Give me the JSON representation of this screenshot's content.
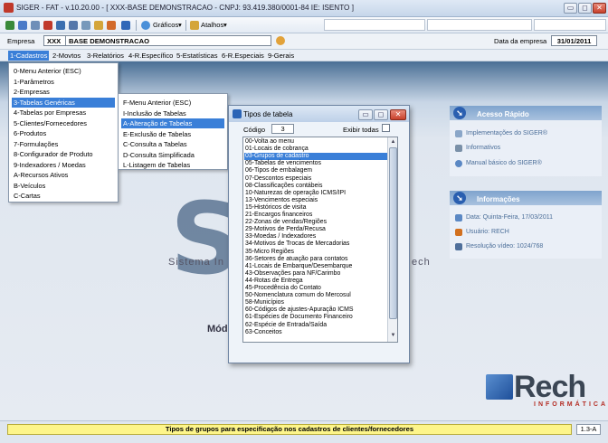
{
  "window": {
    "title": "SIGER - FAT - v.10.20.00 - [ XXX-BASE DEMONSTRACAO - CNPJ: 93.419.380/0001-84 IE: ISENTO ]",
    "minimize": "▭",
    "maximize": "◻",
    "close": "✕"
  },
  "toolbar": {
    "graficos": "Gráficos",
    "atalhos": "Atalhos"
  },
  "empresa": {
    "label": "Empresa",
    "code": "XXX",
    "name": "BASE DEMONSTRACAO",
    "date_label": "Data da empresa",
    "date": "31/01/2011"
  },
  "menu": [
    "1-Cadastros",
    "2-Movtos",
    "3-Relatórios",
    "4-R.Específico",
    "5-Estatísticas",
    "6-R.Especiais",
    "9-Gerais"
  ],
  "cadastros_menu": [
    "0-Menu Anterior (ESC)",
    "1-Parâmetros",
    "2-Empresas",
    "3-Tabelas Genéricas",
    "4-Tabelas por Empresas",
    "5-Clientes/Fornecedores",
    "6-Produtos",
    "7-Formulações",
    "8-Configurador de Produto",
    "9-Indexadores / Moedas",
    "A-Recursos Ativos",
    "B-Veículos",
    "C-Cartas"
  ],
  "tabelas_menu": [
    "F-Menu Anterior (ESC)",
    "I-Inclusão de Tabelas",
    "A-Alteração de Tabelas",
    "E-Exclusão de Tabelas",
    "C-Consulta a Tabelas",
    "D-Consulta Simplificada",
    "L-Listagem de Tabelas"
  ],
  "dialog": {
    "title": "Tipos de tabela",
    "code_label": "Código",
    "code_value": "3",
    "exibir_label": "Exibir todas",
    "items": [
      "00-Volta ao menu",
      "01-Locais de cobrança",
      "03-Grupos de cadastro",
      "05-Tabelas de vencimentos",
      "06-Tipos de embalagem",
      "07-Descontos especiais",
      "08-Classificações contábeis",
      "10-Naturezas de operação ICMS/IPI",
      "13-Vencimentos especiais",
      "15-Históricos de visita",
      "21-Encargos financeiros",
      "22-Zonas de vendas/Regiões",
      "29-Motivos de Perda/Recusa",
      "33-Moedas / Indexadores",
      "34-Motivos de Trocas de Mercadorias",
      "35-Micro Regiões",
      "36-Setores de atuação para contatos",
      "41-Locais de Embarque/Desembarque",
      "43-Observações para NF/Carimbo",
      "44-Rotas de Entrega",
      "45-Procedência do Contato",
      "50-Nomenclatura comum do Mercosul",
      "58-Municípios",
      "60-Códigos de ajustes-Apuração ICMS",
      "61-Espécies de Documento Financeiro",
      "62-Espécie de Entrada/Saída",
      "63-Conceitos"
    ]
  },
  "background": {
    "logo_sub_left": "Sistema In",
    "logo_sub_right": "ech",
    "modulo": "Mód"
  },
  "acesso_rapido": {
    "title": "Acesso Rápido",
    "items": [
      "Implementações do SIGER®",
      "Informativos",
      "Manual básico do SIGER®"
    ]
  },
  "informacoes": {
    "title": "Informações",
    "items": [
      "Data: Quinta-Feira, 17/03/2011",
      "Usuário: RECH",
      "Resolução vídeo: 1024/768"
    ]
  },
  "brand": {
    "name": "Rech",
    "sub": "INFORMÁTICA"
  },
  "status": {
    "message": "Tipos de grupos para especificação nos cadastros de clientes/fornecedores",
    "code": "1.3-A"
  }
}
